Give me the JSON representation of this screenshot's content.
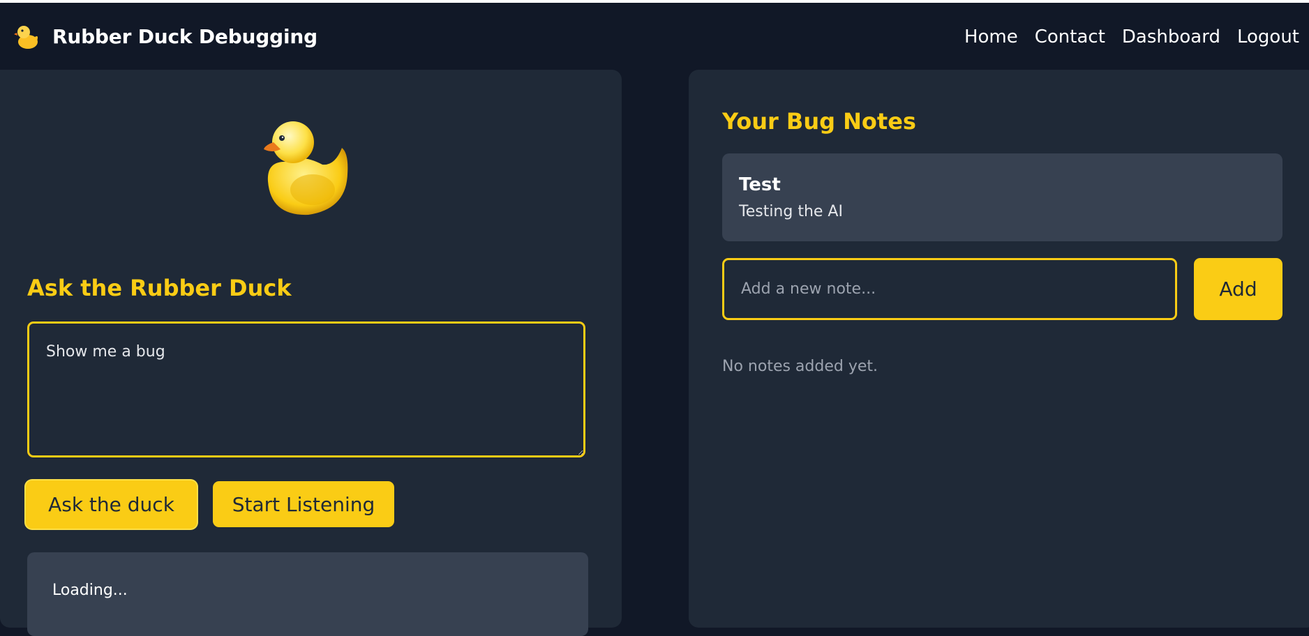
{
  "navbar": {
    "brand_icon": "rubber-duck-icon",
    "brand_title": "Rubber Duck Debugging",
    "links": [
      "Home",
      "Contact",
      "Dashboard",
      "Logout"
    ]
  },
  "ask_panel": {
    "duck_icon": "rubber-duck-icon",
    "title": "Ask the Rubber Duck",
    "input_value": "Show me a bug",
    "ask_button": "Ask the duck",
    "listen_button": "Start Listening",
    "response_text": "Loading..."
  },
  "notes_panel": {
    "title": "Your Bug Notes",
    "notes": [
      {
        "title": "Test",
        "body": "Testing the AI"
      }
    ],
    "input_placeholder": "Add a new note...",
    "add_button": "Add",
    "empty_text": "No notes added yet."
  },
  "colors": {
    "background": "#111827",
    "panel": "#1f2937",
    "card": "#374151",
    "accent": "#facc15"
  }
}
